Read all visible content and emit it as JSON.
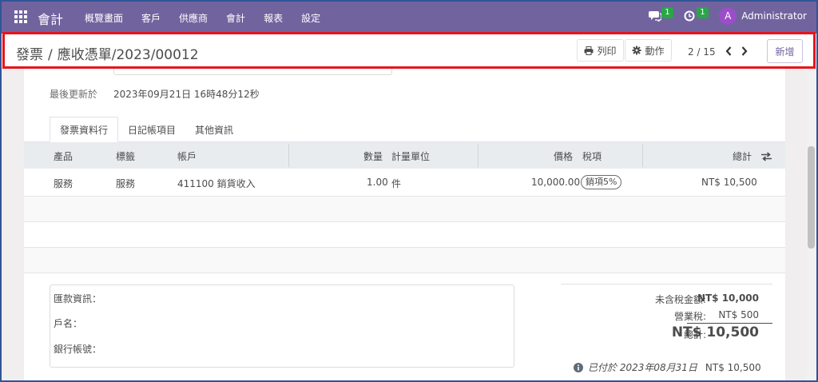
{
  "app": {
    "brand": "會計",
    "menu": [
      "概覽畫面",
      "客戶",
      "供應商",
      "會計",
      "報表",
      "設定"
    ],
    "messages_count": "1",
    "activities_count": "1",
    "user_initial": "A",
    "user_name": "Administrator"
  },
  "control_panel": {
    "breadcrumb_parent": "發票",
    "breadcrumb_sep": "/",
    "breadcrumb_current": "應收憑單/2023/00012",
    "print_label": "列印",
    "action_label": "動作",
    "pager": "2 / 15",
    "new_label": "新增"
  },
  "form": {
    "last_updated_label": "最後更新於",
    "last_updated_value": "2023年09月21日 16時48分12秒",
    "tabs": [
      "發票資料行",
      "日記帳項目",
      "其他資訊"
    ]
  },
  "lines_table": {
    "headers": {
      "product": "產品",
      "label": "標籤",
      "account": "帳戶",
      "quantity": "數量",
      "uom": "計量單位",
      "price": "價格",
      "taxes": "稅項",
      "total": "總計"
    },
    "rows": [
      {
        "product": "服務",
        "label": "服務",
        "account": "411100 銷貨收入",
        "quantity": "1.00",
        "uom": "件",
        "price": "10,000.00",
        "tax": "銷項5%",
        "total": "NT$ 10,500"
      }
    ]
  },
  "payment_info": {
    "remittance": "匯款資訊：",
    "account_name": "戶名：",
    "bank_account": "銀行帳號："
  },
  "totals": {
    "untaxed_label": "未含稅金額:",
    "untaxed_value": "NT$ 10,000",
    "tax_label": "營業稅:",
    "tax_value": "NT$ 500",
    "total_label": "總計:",
    "total_value": "NT$ 10,500",
    "paid_text": "已付於 2023年08月31日",
    "paid_amount": "NT$ 10,500"
  },
  "colors": {
    "navbar": "#71639e",
    "highlight": "#e8141b",
    "badge": "#28a745",
    "avatar": "#9b4dca"
  }
}
